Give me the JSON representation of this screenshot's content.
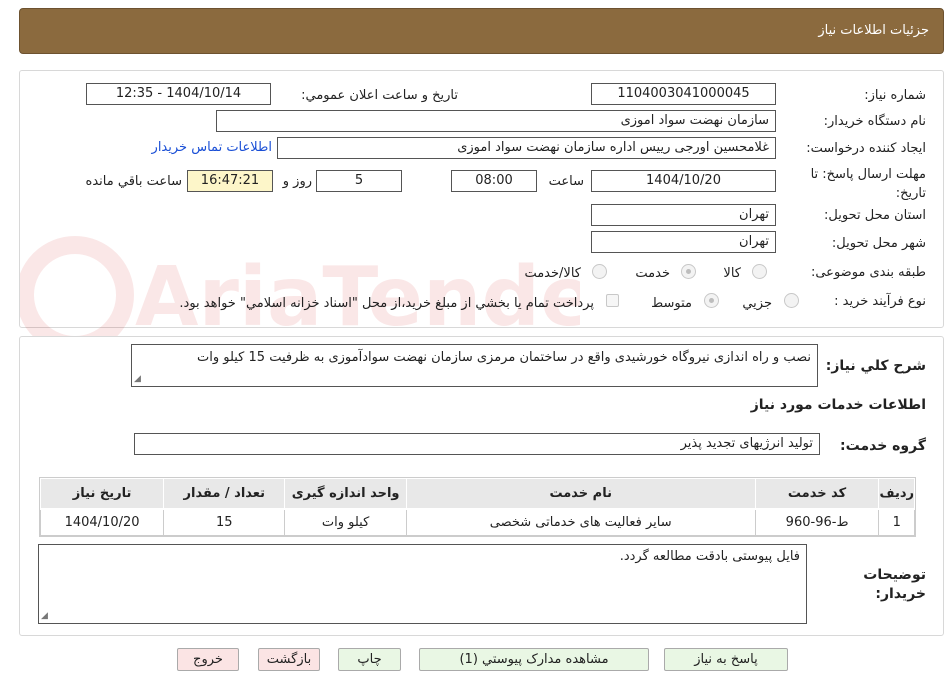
{
  "header": {
    "title": "جزئیات اطلاعات نیاز"
  },
  "fields": {
    "need_number_label": "شماره نیاز:",
    "need_number": "1104003041000045",
    "announce_label": "تاریخ و ساعت اعلان عمومي:",
    "announce_value": "1404/10/14 - 12:35",
    "buyer_org_label": "نام دستگاه خريدار:",
    "buyer_org": "سازمان نهضت سواد اموزی",
    "requester_label": "ایجاد کننده درخواست:",
    "requester": "غلامحسین اورجی رييس اداره سازمان نهضت سواد اموزی",
    "contact_link": "اطلاعات تماس خريدار",
    "deadline_label": "مهلت ارسال پاسخ: تا تاريخ:",
    "deadline_date": "1404/10/20",
    "time_label": "ساعت",
    "deadline_time": "08:00",
    "days_value": "5",
    "days_label": "روز و",
    "remaining_time": "16:47:21",
    "remaining_label": "ساعت باقي مانده",
    "province_label": "استان محل تحويل:",
    "province": "تهران",
    "city_label": "شهر محل تحويل:",
    "city": "تهران",
    "category_label": "طبقه بندی موضوعی:",
    "category_options": [
      "کالا",
      "خدمت",
      "کالا/خدمت"
    ],
    "category_selected": "خدمت",
    "process_label": "نوع فرآیند خرید :",
    "process_options": [
      "جزيي",
      "متوسط"
    ],
    "process_selected": "متوسط",
    "payment_note": "پرداخت تمام يا بخشي از مبلغ خريد،از محل \"اسناد خزانه اسلامي\" خواهد بود."
  },
  "description": {
    "label": "شرح كلي نياز:",
    "text": "نصب و راه اندازی نیروگاه خورشیدی واقع در ساختمان مرمزی سازمان نهضت سوادآموزی به ظرفیت 15 کیلو وات"
  },
  "services": {
    "section_title": "اطلاعات خدمات مورد نياز",
    "group_label": "گروه خدمت:",
    "group_value": "تولید انرژیهای تجدید پذیر",
    "columns": [
      "رديف",
      "کد خدمت",
      "نام خدمت",
      "واحد اندازه گيری",
      "تعداد / مقدار",
      "تاريخ نياز"
    ],
    "rows": [
      [
        "1",
        "ط-96-960",
        "سایر فعالیت های خدماتی شخصی",
        "کیلو وات",
        "15",
        "1404/10/20"
      ]
    ]
  },
  "buyer_notes": {
    "label": "توضيحات خريدار:",
    "text": "فایل پیوستی بادقت مطالعه گردد."
  },
  "buttons": {
    "reply": "پاسخ به نياز",
    "attachments": "مشاهده مدارک پيوستي (1)",
    "print": "چاپ",
    "back": "بازگشت",
    "exit": "خروج"
  },
  "watermark": "AriaTender.neT",
  "colors": {
    "header_bg": "#8b6a3e",
    "link": "#1a4fd6",
    "remaining_bg": "#fdf6c9"
  }
}
